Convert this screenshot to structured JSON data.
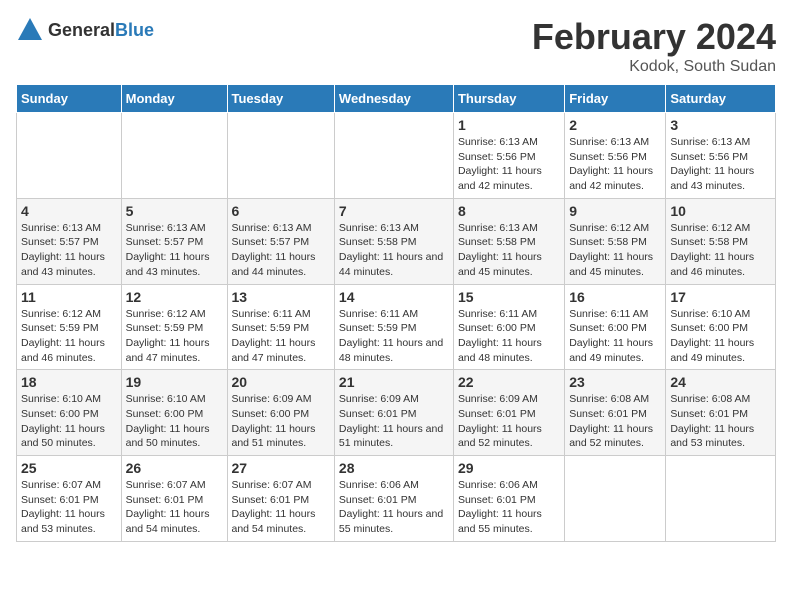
{
  "logo": {
    "general": "General",
    "blue": "Blue"
  },
  "title": "February 2024",
  "subtitle": "Kodok, South Sudan",
  "days_header": [
    "Sunday",
    "Monday",
    "Tuesday",
    "Wednesday",
    "Thursday",
    "Friday",
    "Saturday"
  ],
  "weeks": [
    [
      {
        "day": "",
        "sunrise": "",
        "sunset": "",
        "daylight": ""
      },
      {
        "day": "",
        "sunrise": "",
        "sunset": "",
        "daylight": ""
      },
      {
        "day": "",
        "sunrise": "",
        "sunset": "",
        "daylight": ""
      },
      {
        "day": "",
        "sunrise": "",
        "sunset": "",
        "daylight": ""
      },
      {
        "day": "1",
        "sunrise": "Sunrise: 6:13 AM",
        "sunset": "Sunset: 5:56 PM",
        "daylight": "Daylight: 11 hours and 42 minutes."
      },
      {
        "day": "2",
        "sunrise": "Sunrise: 6:13 AM",
        "sunset": "Sunset: 5:56 PM",
        "daylight": "Daylight: 11 hours and 42 minutes."
      },
      {
        "day": "3",
        "sunrise": "Sunrise: 6:13 AM",
        "sunset": "Sunset: 5:56 PM",
        "daylight": "Daylight: 11 hours and 43 minutes."
      }
    ],
    [
      {
        "day": "4",
        "sunrise": "Sunrise: 6:13 AM",
        "sunset": "Sunset: 5:57 PM",
        "daylight": "Daylight: 11 hours and 43 minutes."
      },
      {
        "day": "5",
        "sunrise": "Sunrise: 6:13 AM",
        "sunset": "Sunset: 5:57 PM",
        "daylight": "Daylight: 11 hours and 43 minutes."
      },
      {
        "day": "6",
        "sunrise": "Sunrise: 6:13 AM",
        "sunset": "Sunset: 5:57 PM",
        "daylight": "Daylight: 11 hours and 44 minutes."
      },
      {
        "day": "7",
        "sunrise": "Sunrise: 6:13 AM",
        "sunset": "Sunset: 5:58 PM",
        "daylight": "Daylight: 11 hours and 44 minutes."
      },
      {
        "day": "8",
        "sunrise": "Sunrise: 6:13 AM",
        "sunset": "Sunset: 5:58 PM",
        "daylight": "Daylight: 11 hours and 45 minutes."
      },
      {
        "day": "9",
        "sunrise": "Sunrise: 6:12 AM",
        "sunset": "Sunset: 5:58 PM",
        "daylight": "Daylight: 11 hours and 45 minutes."
      },
      {
        "day": "10",
        "sunrise": "Sunrise: 6:12 AM",
        "sunset": "Sunset: 5:58 PM",
        "daylight": "Daylight: 11 hours and 46 minutes."
      }
    ],
    [
      {
        "day": "11",
        "sunrise": "Sunrise: 6:12 AM",
        "sunset": "Sunset: 5:59 PM",
        "daylight": "Daylight: 11 hours and 46 minutes."
      },
      {
        "day": "12",
        "sunrise": "Sunrise: 6:12 AM",
        "sunset": "Sunset: 5:59 PM",
        "daylight": "Daylight: 11 hours and 47 minutes."
      },
      {
        "day": "13",
        "sunrise": "Sunrise: 6:11 AM",
        "sunset": "Sunset: 5:59 PM",
        "daylight": "Daylight: 11 hours and 47 minutes."
      },
      {
        "day": "14",
        "sunrise": "Sunrise: 6:11 AM",
        "sunset": "Sunset: 5:59 PM",
        "daylight": "Daylight: 11 hours and 48 minutes."
      },
      {
        "day": "15",
        "sunrise": "Sunrise: 6:11 AM",
        "sunset": "Sunset: 6:00 PM",
        "daylight": "Daylight: 11 hours and 48 minutes."
      },
      {
        "day": "16",
        "sunrise": "Sunrise: 6:11 AM",
        "sunset": "Sunset: 6:00 PM",
        "daylight": "Daylight: 11 hours and 49 minutes."
      },
      {
        "day": "17",
        "sunrise": "Sunrise: 6:10 AM",
        "sunset": "Sunset: 6:00 PM",
        "daylight": "Daylight: 11 hours and 49 minutes."
      }
    ],
    [
      {
        "day": "18",
        "sunrise": "Sunrise: 6:10 AM",
        "sunset": "Sunset: 6:00 PM",
        "daylight": "Daylight: 11 hours and 50 minutes."
      },
      {
        "day": "19",
        "sunrise": "Sunrise: 6:10 AM",
        "sunset": "Sunset: 6:00 PM",
        "daylight": "Daylight: 11 hours and 50 minutes."
      },
      {
        "day": "20",
        "sunrise": "Sunrise: 6:09 AM",
        "sunset": "Sunset: 6:00 PM",
        "daylight": "Daylight: 11 hours and 51 minutes."
      },
      {
        "day": "21",
        "sunrise": "Sunrise: 6:09 AM",
        "sunset": "Sunset: 6:01 PM",
        "daylight": "Daylight: 11 hours and 51 minutes."
      },
      {
        "day": "22",
        "sunrise": "Sunrise: 6:09 AM",
        "sunset": "Sunset: 6:01 PM",
        "daylight": "Daylight: 11 hours and 52 minutes."
      },
      {
        "day": "23",
        "sunrise": "Sunrise: 6:08 AM",
        "sunset": "Sunset: 6:01 PM",
        "daylight": "Daylight: 11 hours and 52 minutes."
      },
      {
        "day": "24",
        "sunrise": "Sunrise: 6:08 AM",
        "sunset": "Sunset: 6:01 PM",
        "daylight": "Daylight: 11 hours and 53 minutes."
      }
    ],
    [
      {
        "day": "25",
        "sunrise": "Sunrise: 6:07 AM",
        "sunset": "Sunset: 6:01 PM",
        "daylight": "Daylight: 11 hours and 53 minutes."
      },
      {
        "day": "26",
        "sunrise": "Sunrise: 6:07 AM",
        "sunset": "Sunset: 6:01 PM",
        "daylight": "Daylight: 11 hours and 54 minutes."
      },
      {
        "day": "27",
        "sunrise": "Sunrise: 6:07 AM",
        "sunset": "Sunset: 6:01 PM",
        "daylight": "Daylight: 11 hours and 54 minutes."
      },
      {
        "day": "28",
        "sunrise": "Sunrise: 6:06 AM",
        "sunset": "Sunset: 6:01 PM",
        "daylight": "Daylight: 11 hours and 55 minutes."
      },
      {
        "day": "29",
        "sunrise": "Sunrise: 6:06 AM",
        "sunset": "Sunset: 6:01 PM",
        "daylight": "Daylight: 11 hours and 55 minutes."
      },
      {
        "day": "",
        "sunrise": "",
        "sunset": "",
        "daylight": ""
      },
      {
        "day": "",
        "sunrise": "",
        "sunset": "",
        "daylight": ""
      }
    ]
  ]
}
